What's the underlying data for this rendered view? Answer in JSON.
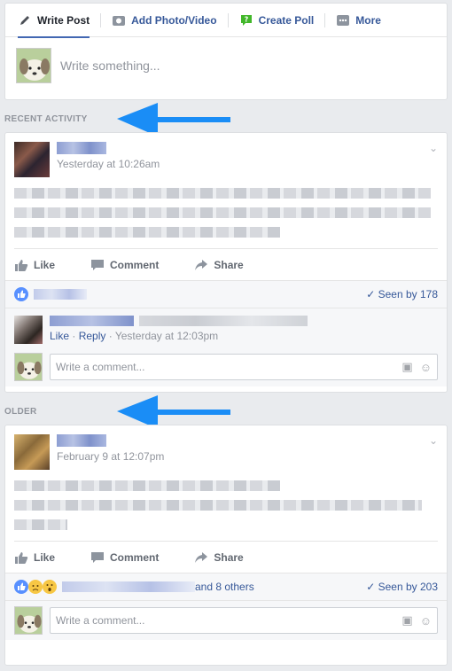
{
  "composer": {
    "tabs": [
      {
        "label": "Write Post",
        "icon": "pencil-icon"
      },
      {
        "label": "Add Photo/Video",
        "icon": "camera-icon"
      },
      {
        "label": "Create Poll",
        "icon": "poll-icon"
      },
      {
        "label": "More",
        "icon": "more-icon"
      }
    ],
    "placeholder": "Write something..."
  },
  "sections": {
    "recent": "RECENT ACTIVITY",
    "older": "OLDER"
  },
  "posts": [
    {
      "time": "Yesterday at 10:26am",
      "actions": {
        "like": "Like",
        "comment": "Comment",
        "share": "Share"
      },
      "seen": "Seen by 178",
      "comment": {
        "like": "Like",
        "dot": "·",
        "reply": "Reply",
        "time": "Yesterday at 12:03pm"
      },
      "comment_placeholder": "Write a comment..."
    },
    {
      "time": "February 9 at 12:07pm",
      "actions": {
        "like": "Like",
        "comment": "Comment",
        "share": "Share"
      },
      "others": "and 8 others",
      "seen": "Seen by 203",
      "comment_placeholder": "Write a comment..."
    }
  ],
  "colors": {
    "accent": "#4267b2",
    "link": "#365899",
    "arrow": "#1a8df6"
  }
}
